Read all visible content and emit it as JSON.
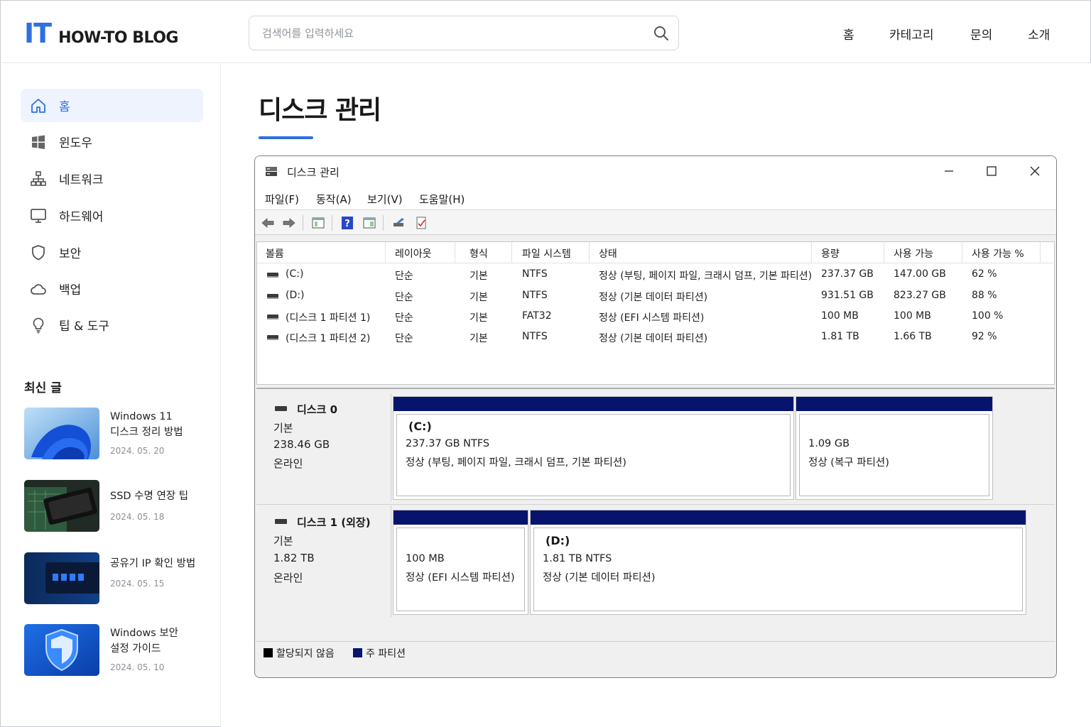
{
  "site": {
    "logo_mark": "IT",
    "logo_text": "HOW-TO BLOG"
  },
  "search": {
    "placeholder": "검색어를 입력하세요",
    "value": ""
  },
  "topnav": [
    "홈",
    "카테고리",
    "문의",
    "소개"
  ],
  "sidebar": {
    "items": [
      {
        "label": "홈",
        "icon": "home-icon",
        "active": true
      },
      {
        "label": "윈도우",
        "icon": "windows-icon"
      },
      {
        "label": "네트워크",
        "icon": "network-icon"
      },
      {
        "label": "하드웨어",
        "icon": "monitor-icon"
      },
      {
        "label": "보안",
        "icon": "shield-icon"
      },
      {
        "label": "백업",
        "icon": "cloud-icon"
      },
      {
        "label": "팁 & 도구",
        "icon": "lightbulb-icon"
      }
    ],
    "recent_title": "최신 글",
    "recent": [
      {
        "title_line1": "Windows 11",
        "title_line2": "디스크 정리 방법",
        "date": "2024. 05. 20"
      },
      {
        "title_line1": "SSD 수명 연장 팁",
        "title_line2": "",
        "date": "2024. 05. 18"
      },
      {
        "title_line1": "공유기 IP 확인 방법",
        "title_line2": "",
        "date": "2024. 05. 15"
      },
      {
        "title_line1": "Windows 보안",
        "title_line2": "설정 가이드",
        "date": "2024. 05. 10"
      }
    ]
  },
  "main": {
    "title": "디스크 관리"
  },
  "window": {
    "title": "디스크 관리",
    "menu": [
      "파일(F)",
      "동작(A)",
      "보기(V)",
      "도움말(H)"
    ],
    "columns": [
      "볼륨",
      "레이아웃",
      "형식",
      "파일 시스템",
      "상태",
      "용량",
      "사용 가능",
      "사용 가능 %"
    ],
    "volumes": [
      [
        "(C:)",
        "단순",
        "기본",
        "NTFS",
        "정상 (부팅, 페이지 파일, 크래시 덤프, 기본 파티션)",
        "237.37 GB",
        "147.00 GB",
        "62 %"
      ],
      [
        "(D:)",
        "단순",
        "기본",
        "NTFS",
        "정상 (기본 데이터 파티션)",
        "931.51 GB",
        "823.27 GB",
        "88 %"
      ],
      [
        "(디스크 1 파티션 1)",
        "단순",
        "기본",
        "FAT32",
        "정상 (EFI 시스템 파티션)",
        "100 MB",
        "100 MB",
        "100 %"
      ],
      [
        "(디스크 1 파티션 2)",
        "단순",
        "기본",
        "NTFS",
        "정상 (기본 데이터 파티션)",
        "1.81 TB",
        "1.66 TB",
        "92 %"
      ]
    ],
    "disks": [
      {
        "name": "디스크 0",
        "type": "기본",
        "size": "238.46 GB",
        "status": "온라인",
        "partitions": [
          {
            "name": "(C:)",
            "line1": "237.37 GB NTFS",
            "line2": "정상 (부팅, 페이지 파일, 크래시 덤프, 기본 파티션)"
          },
          {
            "name": "",
            "line1": "1.09 GB",
            "line2": "정상 (복구 파티션)"
          }
        ]
      },
      {
        "name": "디스크 1 (외장)",
        "type": "기본",
        "size": "1.82 TB",
        "status": "온라인",
        "partitions": [
          {
            "name": "",
            "line1": "100 MB",
            "line2": "정상 (EFI 시스템 파티션)"
          },
          {
            "name": "(D:)",
            "line1": "1.81 TB NTFS",
            "line2": "정상 (기본 데이터 파티션)"
          }
        ]
      }
    ],
    "legend": [
      {
        "label": "할당되지 않음",
        "color": "#000000"
      },
      {
        "label": "주 파티션",
        "color": "#06146e"
      }
    ]
  },
  "colors": {
    "accent": "#2f6fe0",
    "primary_partition": "#06146e"
  }
}
